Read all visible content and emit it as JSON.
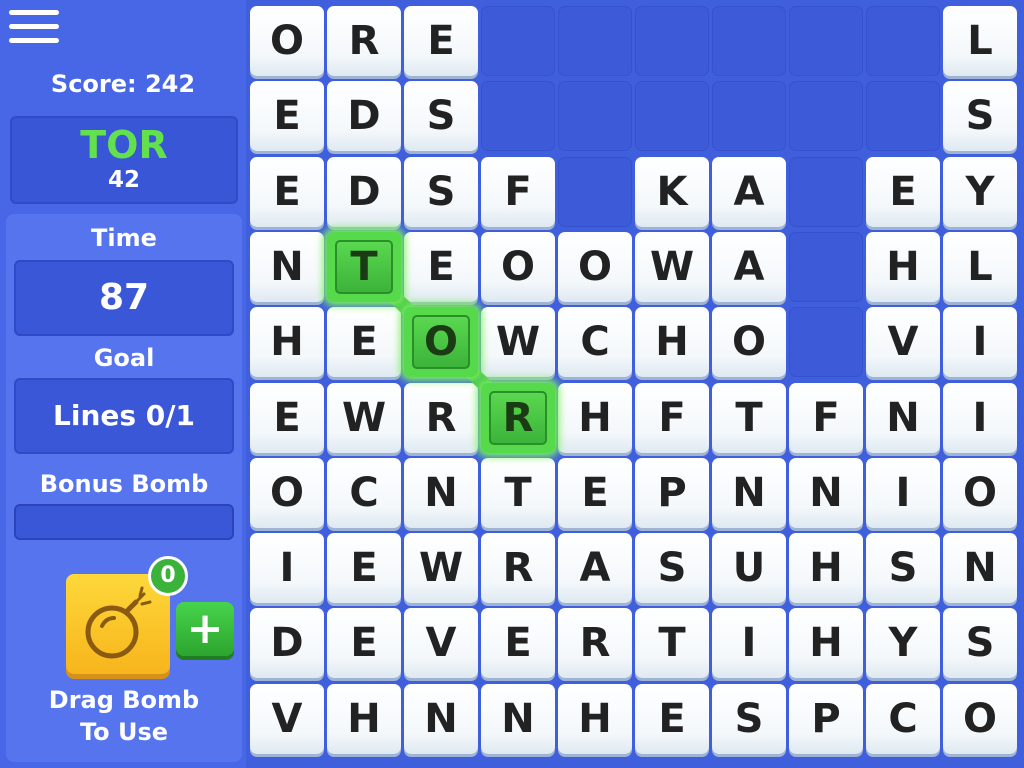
{
  "sidebar": {
    "score_text": "Score: 242",
    "current_word": "TOR",
    "current_word_points": "42",
    "time_label": "Time",
    "time_value": "87",
    "goal_label": "Goal",
    "goal_value": "Lines 0/1",
    "bonus_bomb_label": "Bonus Bomb",
    "bonus_bomb_progress": 0,
    "bomb_count": "0",
    "plus_label": "+",
    "drag_label_line1": "Drag Bomb",
    "drag_label_line2": "To Use"
  },
  "board": {
    "rows": [
      [
        "O",
        "R",
        "E",
        "",
        "",
        "",
        "",
        "",
        "",
        "L"
      ],
      [
        "E",
        "D",
        "S",
        "",
        "",
        "",
        "",
        "",
        "",
        "S"
      ],
      [
        "E",
        "D",
        "S",
        "F",
        "",
        "K",
        "A",
        "",
        "E",
        "Y"
      ],
      [
        "N",
        "T",
        "E",
        "O",
        "O",
        "W",
        "A",
        "",
        "H",
        "L"
      ],
      [
        "H",
        "E",
        "O",
        "W",
        "C",
        "H",
        "O",
        "",
        "V",
        "I"
      ],
      [
        "E",
        "W",
        "R",
        "R",
        "H",
        "F",
        "T",
        "F",
        "N",
        "I"
      ],
      [
        "O",
        "C",
        "N",
        "T",
        "E",
        "P",
        "N",
        "N",
        "I",
        "O"
      ],
      [
        "I",
        "E",
        "W",
        "R",
        "A",
        "S",
        "U",
        "H",
        "S",
        "N"
      ],
      [
        "D",
        "E",
        "V",
        "E",
        "R",
        "T",
        "I",
        "H",
        "Y",
        "S"
      ],
      [
        "V",
        "H",
        "N",
        "N",
        "H",
        "E",
        "S",
        "P",
        "C",
        "O"
      ]
    ],
    "selected_path": [
      [
        3,
        1
      ],
      [
        4,
        2
      ],
      [
        5,
        3
      ]
    ]
  },
  "colors": {
    "background": "#3f5fdc",
    "selected_tile": "#56d94b",
    "word_highlight": "#63e04d",
    "bomb": "#f7b51c"
  },
  "icons": {
    "menu": "hamburger-menu-icon",
    "bomb": "bomb-icon",
    "plus": "plus-icon"
  }
}
